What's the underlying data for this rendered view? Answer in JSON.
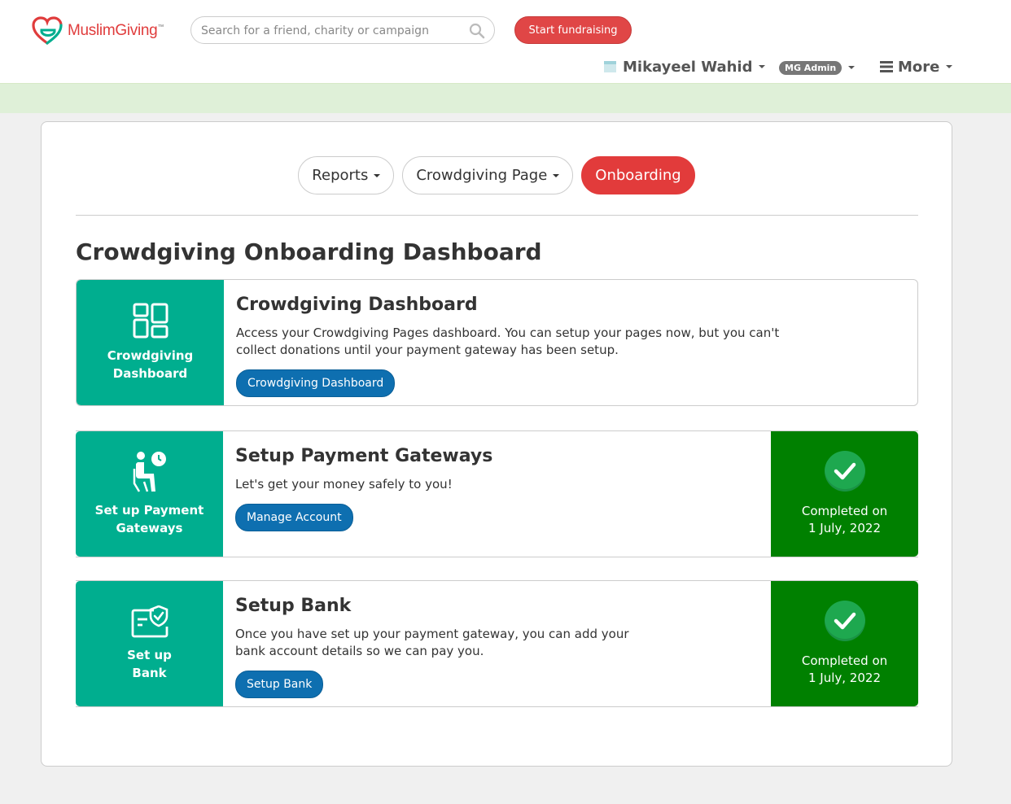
{
  "brand": {
    "name_part1": "Muslim",
    "name_part2": "Giving",
    "trademark": "™",
    "color_primary": "#e03c3c",
    "color_teal": "#00ae8f"
  },
  "search": {
    "placeholder": "Search for a friend, charity or campaign"
  },
  "header": {
    "start_button": "Start fundraising",
    "user_name": "Mikayeel Wahid",
    "admin_badge": "MG Admin",
    "more_label": "More"
  },
  "tabs": [
    {
      "label": "Reports",
      "active": false
    },
    {
      "label": "Crowdgiving Page",
      "active": false
    },
    {
      "label": "Onboarding",
      "active": true
    }
  ],
  "page": {
    "title": "Crowdgiving Onboarding Dashboard"
  },
  "steps": [
    {
      "tile_label": "Crowdgiving Dashboard",
      "title": "Crowdgiving Dashboard",
      "description": "Access your Crowdgiving Pages dashboard. You can setup your pages now, but you can't collect donations until your payment gateway has been setup.",
      "button": "Crowdgiving Dashboard",
      "icon": "dashboard-icon"
    },
    {
      "tile_label": "Set up Payment Gateways",
      "title": "Setup Payment Gateways",
      "description": "Let's get your money safely to you!",
      "button": "Manage Account",
      "icon": "person-clock-icon",
      "completed_label": "Completed on",
      "completed_date": "1 July, 2022"
    },
    {
      "tile_label": "Set up Bank",
      "title": "Setup Bank",
      "description": "Once you have set up your payment gateway, you can add your bank account details so we can pay you.",
      "button": "Setup Bank",
      "icon": "bank-card-shield-icon",
      "completed_label": "Completed on",
      "completed_date": "1 July, 2022"
    }
  ],
  "colors": {
    "completed_bg": "#008000",
    "button_blue": "#0e6fb0",
    "active_tab": "#e23b3b",
    "notice_strip": "#dff0d8"
  }
}
